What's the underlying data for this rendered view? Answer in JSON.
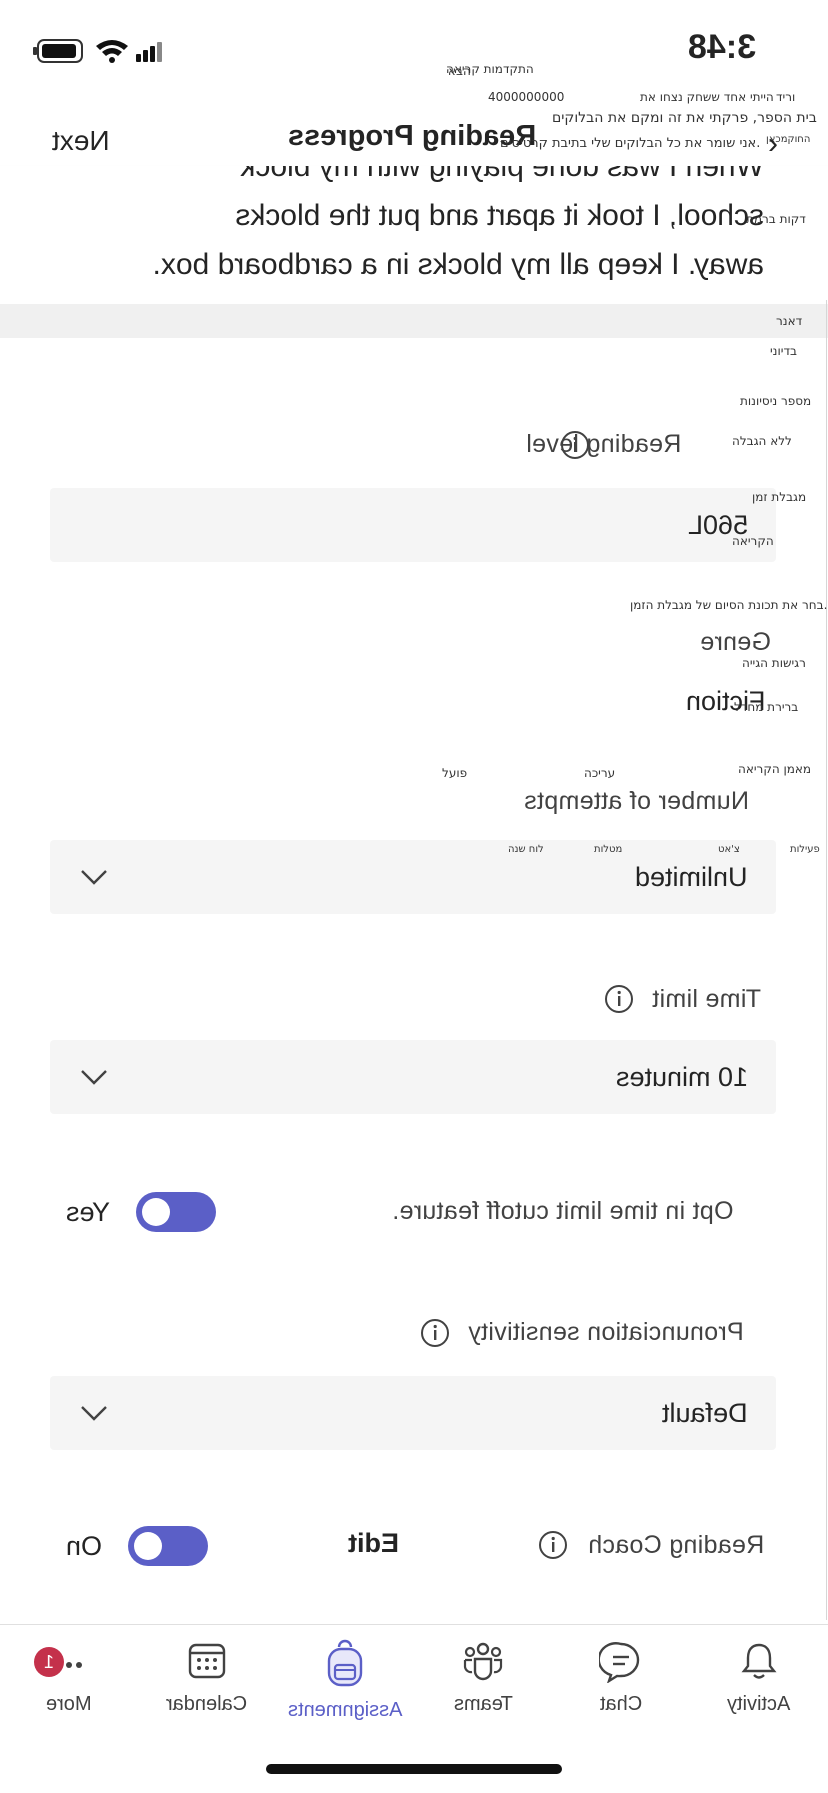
{
  "status_bar": {
    "time": "3:48"
  },
  "header": {
    "next_label": "Next",
    "title": "Reading Progress",
    "passage": [
      "When I was done playing with my block",
      "school, I took it apart and put the blocks",
      "away. I keep all my blocks in a cardboard box."
    ]
  },
  "settings": {
    "reading_level": {
      "label": "Reading level",
      "value": "560L"
    },
    "genre": {
      "label": "Genre",
      "value": "Fiction"
    },
    "attempts": {
      "label": "Number of attempts",
      "value": "Unlimited"
    },
    "time_limit": {
      "label": "Time limit",
      "value": "10 minutes"
    },
    "cutoff": {
      "label": "Opt in time limit cutoff feature.",
      "toggle_label": "Yes"
    },
    "pronunciation": {
      "label": "Pronunciation sensitivity",
      "value": "Default"
    },
    "coach": {
      "label": "Reading Coach",
      "edit_label": "Edit",
      "toggle_label": "On"
    }
  },
  "tabs": [
    {
      "label": "Activity",
      "icon": "bell-icon"
    },
    {
      "label": "Chat",
      "icon": "chat-icon"
    },
    {
      "label": "Teams",
      "icon": "teams-icon"
    },
    {
      "label": "Assignments",
      "icon": "backpack-icon"
    },
    {
      "label": "Calendar",
      "icon": "calendar-icon"
    },
    {
      "label": "More",
      "icon": "more-icon",
      "badge": "1"
    }
  ],
  "overlay_hebrew": {
    "t1": "התקדמות קריאה",
    "t2": "הבא",
    "t3": "4000000000",
    "t4": "הייתי אחד ששחק נצחו את",
    "t5": "וריד",
    "t6": "בית הספר, פרקתי את זה ומקם את הבלוקים",
    "t7": "החוקמכאן",
    "t8": "אני שומר את כל הבלוקים שלי בתיבת קרטיסים.",
    "t9": "דקות ברמת",
    "t10": "דאנר",
    "t11": "בדיוני",
    "t12": "מספר ניסיונות",
    "t13": "ללא הגבלה",
    "t14": "מגבלת זמן",
    "t15": "הקריאה",
    "t16": "בחר את תכונת הסיום של מגבלת הזמן.",
    "t17": "רגישות הגייה",
    "t18": "ברירת מחדל",
    "t19": "מאמן הקריאה",
    "t20": "עריכה",
    "t21": "פועל",
    "t22": "פעילות",
    "t23": "צ'אט",
    "t24": "מטלות",
    "t25": "לוח שנה"
  },
  "colors": {
    "accent": "#5b5fc7",
    "field_bg": "#f5f5f5",
    "badge": "#c4314b"
  }
}
